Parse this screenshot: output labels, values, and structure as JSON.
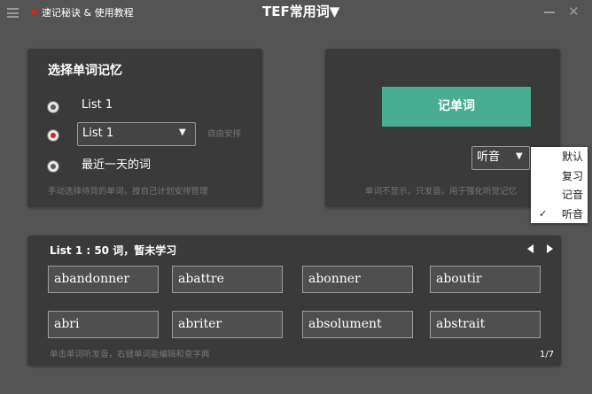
{
  "titlebar": {
    "tips_label": "速记秘诀 & 使用教程",
    "title": "TEF常用词▼"
  },
  "select_panel": {
    "title": "选择单词记忆",
    "options": [
      {
        "label": "List 1",
        "checked": false
      },
      {
        "label": "",
        "checked": true
      },
      {
        "label": "最近一天的词",
        "checked": false
      }
    ],
    "list_select_value": "List 1",
    "free_arrange_label": "自由安排",
    "hint": "手动选择待背的单词，按自己计划安排管理"
  },
  "memorize_panel": {
    "button_label": "记单词",
    "mode_select_value": "听音",
    "hint": "单词不显示，只发音。用于强化听觉记忆"
  },
  "mode_dropdown": {
    "items": [
      {
        "label": "默认",
        "selected": false
      },
      {
        "label": "复习",
        "selected": false
      },
      {
        "label": "记音",
        "selected": false
      },
      {
        "label": "听音",
        "selected": true
      }
    ]
  },
  "words_panel": {
    "title": "List 1 : 50 词，暂未学习",
    "words": [
      "abandonner",
      "abattre",
      "abonner",
      "aboutir",
      "abri",
      "abriter",
      "absolument",
      "abstrait"
    ],
    "hint": "单击单词听发音，右键单词能编辑和查字典",
    "page": "1/7"
  },
  "colors": {
    "background": "#545454",
    "panel": "#3a3a3a",
    "accent_green": "#48ad91",
    "radio_checked": "#e21c24",
    "star": "#e02020"
  }
}
